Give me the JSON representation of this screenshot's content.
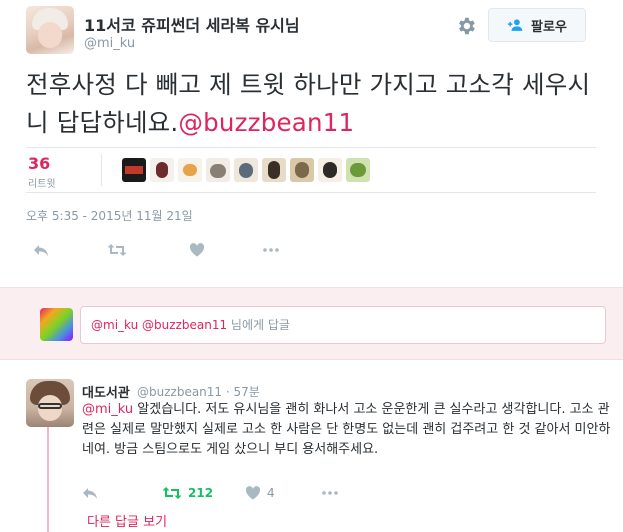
{
  "header": {
    "display_name": "11서코 쥬피썬더 세라복 유시님",
    "handle": "@mi_ku",
    "follow_label": "팔로우",
    "gear_icon": "gear-icon",
    "follow_icon": "add-user-icon"
  },
  "tweet": {
    "text_before": "전후사정 다 빼고 제 트윗 하나만 가지고 고소각 세우시니 답답하네요.",
    "mention": "@buzzbean11",
    "retweet_count": "36",
    "retweet_label": "리트윗",
    "timestamp": "오후 5:35 - 2015년 11월 21일",
    "actions": [
      "reply-icon",
      "retweet-icon",
      "like-icon",
      "more-icon"
    ]
  },
  "reply_box": {
    "mention_1": "@mi_ku",
    "mention_2": "@buzzbean11",
    "suffix": " 님에게 답글"
  },
  "reply": {
    "display_name": "대도서관",
    "handle_time": "@buzzbean11 · 57분",
    "mention": "@mi_ku",
    "text": " 알겠습니다. 저도 유시님을 괜히 화나서 고소 운운한게 큰 실수라고 생각합니다. 고소 관련은 실제로 말만했지 실제로 고소 한 사람은 단 한명도 없는데 괜히 겁주려고 한 것 같아서 미안하네여. 방금 스팀으로도 게임 샀으니 부디 용서해주세요.",
    "retweet_count": "212",
    "like_count": "4",
    "more_replies": "다른 답글 보기"
  },
  "colors": {
    "accent": "#e0245e",
    "retweet_green": "#17bf63",
    "muted": "#8899a6",
    "reply_band": "#fbeef1"
  }
}
